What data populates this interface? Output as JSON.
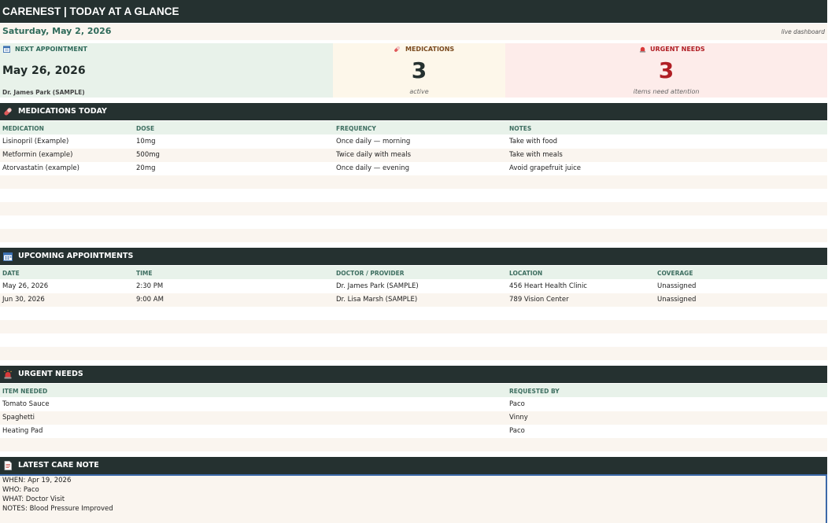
{
  "header": {
    "title": "CARENEST  |  TODAY AT A GLANCE"
  },
  "date_bar": {
    "date": "Saturday, May 2, 2026",
    "status": "live dashboard"
  },
  "cards": {
    "next_appointment": {
      "title": "NEXT APPOINTMENT",
      "date": "May 26, 2026",
      "doctor": "Dr. James Park (SAMPLE)",
      "icon": "calendar-icon"
    },
    "medications": {
      "title": "MEDICATIONS",
      "count": "3",
      "caption": "active",
      "icon": "pill-icon"
    },
    "urgent_needs": {
      "title": "URGENT NEEDS",
      "count": "3",
      "caption": "items need attention",
      "icon": "alarm-icon"
    }
  },
  "medications_section": {
    "title": "MEDICATIONS TODAY",
    "columns": [
      "MEDICATION",
      "DOSE",
      "FREQUENCY",
      "NOTES"
    ],
    "rows": [
      [
        "Lisinopril (Example)",
        "10mg",
        "Once daily — morning",
        "Take with food"
      ],
      [
        "Metformin (example)",
        "500mg",
        "Twice daily with meals",
        "Take with meals"
      ],
      [
        "Atorvastatin (example)",
        "20mg",
        "Once daily — evening",
        "Avoid grapefruit juice"
      ]
    ]
  },
  "appointments_section": {
    "title": "UPCOMING APPOINTMENTS",
    "columns": [
      "DATE",
      "TIME",
      "DOCTOR / PROVIDER",
      "LOCATION",
      "COVERAGE"
    ],
    "rows": [
      [
        "May 26, 2026",
        "2:30 PM",
        "Dr. James Park (SAMPLE)",
        "456 Heart Health Clinic",
        "Unassigned"
      ],
      [
        "Jun 30, 2026",
        "9:00 AM",
        "Dr. Lisa Marsh (SAMPLE)",
        "789 Vision Center",
        "Unassigned"
      ]
    ]
  },
  "urgent_section": {
    "title": "URGENT NEEDS",
    "columns": [
      "ITEM NEEDED",
      "REQUESTED BY"
    ],
    "rows": [
      [
        "Tomato Sauce",
        "Paco"
      ],
      [
        "Spaghetti",
        "Vinny"
      ],
      [
        "Heating Pad",
        "Paco"
      ]
    ]
  },
  "care_note_section": {
    "title": "LATEST CARE NOTE",
    "lines": [
      "WHEN: Apr 19, 2026",
      "WHO: Paco",
      "WHAT: Doctor Visit",
      "NOTES: Blood Pressure Improved"
    ]
  },
  "colors": {
    "header_bg": "#253130",
    "accent_green": "#2f6a5a",
    "urgent_red": "#b01e24",
    "note_border": "#3c69a8"
  }
}
